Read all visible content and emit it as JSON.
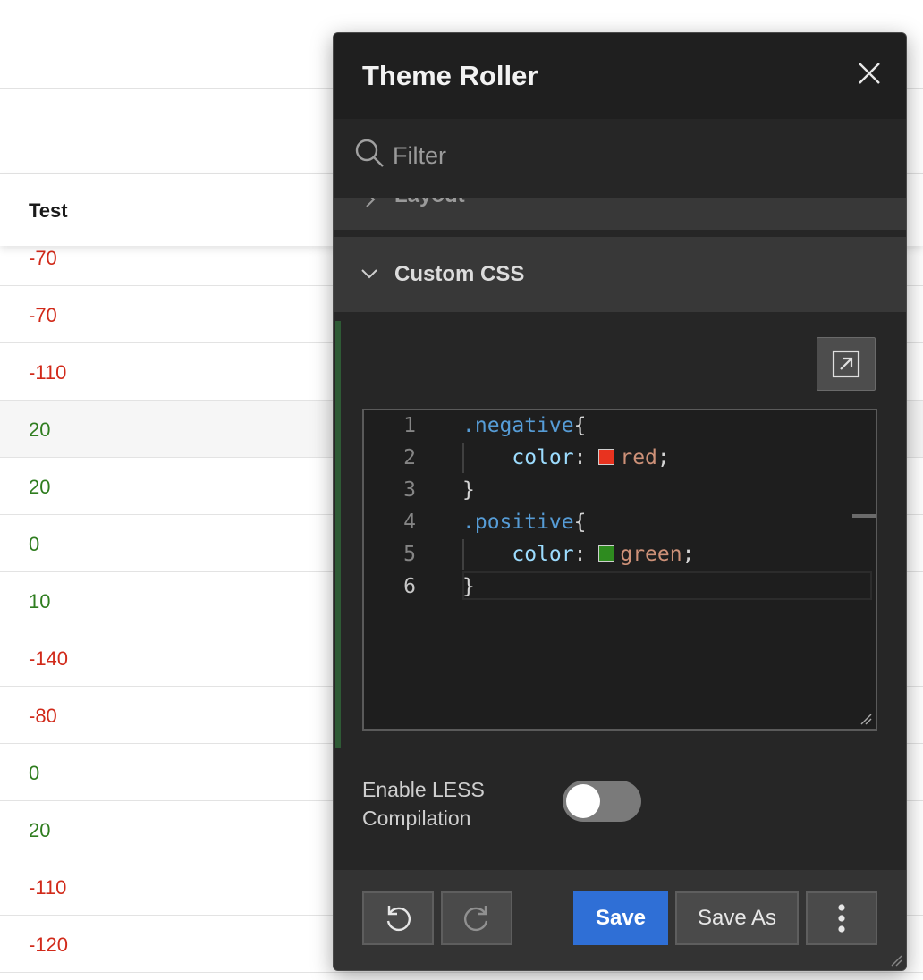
{
  "report": {
    "column_header": "Test",
    "rows": [
      {
        "value": "-70",
        "kind": "negative"
      },
      {
        "value": "-70",
        "kind": "negative"
      },
      {
        "value": "-110",
        "kind": "negative"
      },
      {
        "value": "20",
        "kind": "positive"
      },
      {
        "value": "20",
        "kind": "positive"
      },
      {
        "value": "0",
        "kind": "positive"
      },
      {
        "value": "10",
        "kind": "positive"
      },
      {
        "value": "-140",
        "kind": "negative"
      },
      {
        "value": "-80",
        "kind": "negative"
      },
      {
        "value": "0",
        "kind": "positive"
      },
      {
        "value": "20",
        "kind": "positive"
      },
      {
        "value": "-110",
        "kind": "negative"
      },
      {
        "value": "-120",
        "kind": "negative"
      }
    ],
    "colors": {
      "negative": "#d12a1a",
      "positive": "#2f7d1f"
    }
  },
  "dialog": {
    "title": "Theme Roller",
    "filter_placeholder": "Filter",
    "sections": {
      "layout": "Layout",
      "custom_css": "Custom CSS"
    },
    "editor": {
      "lines": [
        {
          "num": "1",
          "parts": [
            {
              "t": ".negative",
              "c": "c-sel"
            },
            {
              "t": "{",
              "c": ""
            }
          ]
        },
        {
          "num": "2",
          "parts": [
            {
              "t": "    ",
              "c": ""
            },
            {
              "t": "color",
              "c": "c-prop"
            },
            {
              "t": ": ",
              "c": ""
            },
            {
              "t": "SWATCH:#e8331f",
              "c": ""
            },
            {
              "t": "red",
              "c": "c-val"
            },
            {
              "t": ";",
              "c": ""
            }
          ]
        },
        {
          "num": "3",
          "parts": [
            {
              "t": "}",
              "c": ""
            }
          ]
        },
        {
          "num": "4",
          "parts": [
            {
              "t": ".positive",
              "c": "c-sel"
            },
            {
              "t": "{",
              "c": ""
            }
          ]
        },
        {
          "num": "5",
          "parts": [
            {
              "t": "    ",
              "c": ""
            },
            {
              "t": "color",
              "c": "c-prop"
            },
            {
              "t": ": ",
              "c": ""
            },
            {
              "t": "SWATCH:#2e8b1f",
              "c": ""
            },
            {
              "t": "green",
              "c": "c-val"
            },
            {
              "t": ";",
              "c": ""
            }
          ]
        },
        {
          "num": "6",
          "parts": [
            {
              "t": "}",
              "c": ""
            }
          ]
        }
      ],
      "current_line": "6"
    },
    "less_label": "Enable LESS Compilation",
    "less_enabled": false,
    "footer": {
      "undo_icon": "undo-icon",
      "redo_icon": "redo-icon",
      "save": "Save",
      "save_as": "Save As",
      "more_icon": "more-vertical-icon"
    },
    "accent": "#2f6fd6"
  }
}
